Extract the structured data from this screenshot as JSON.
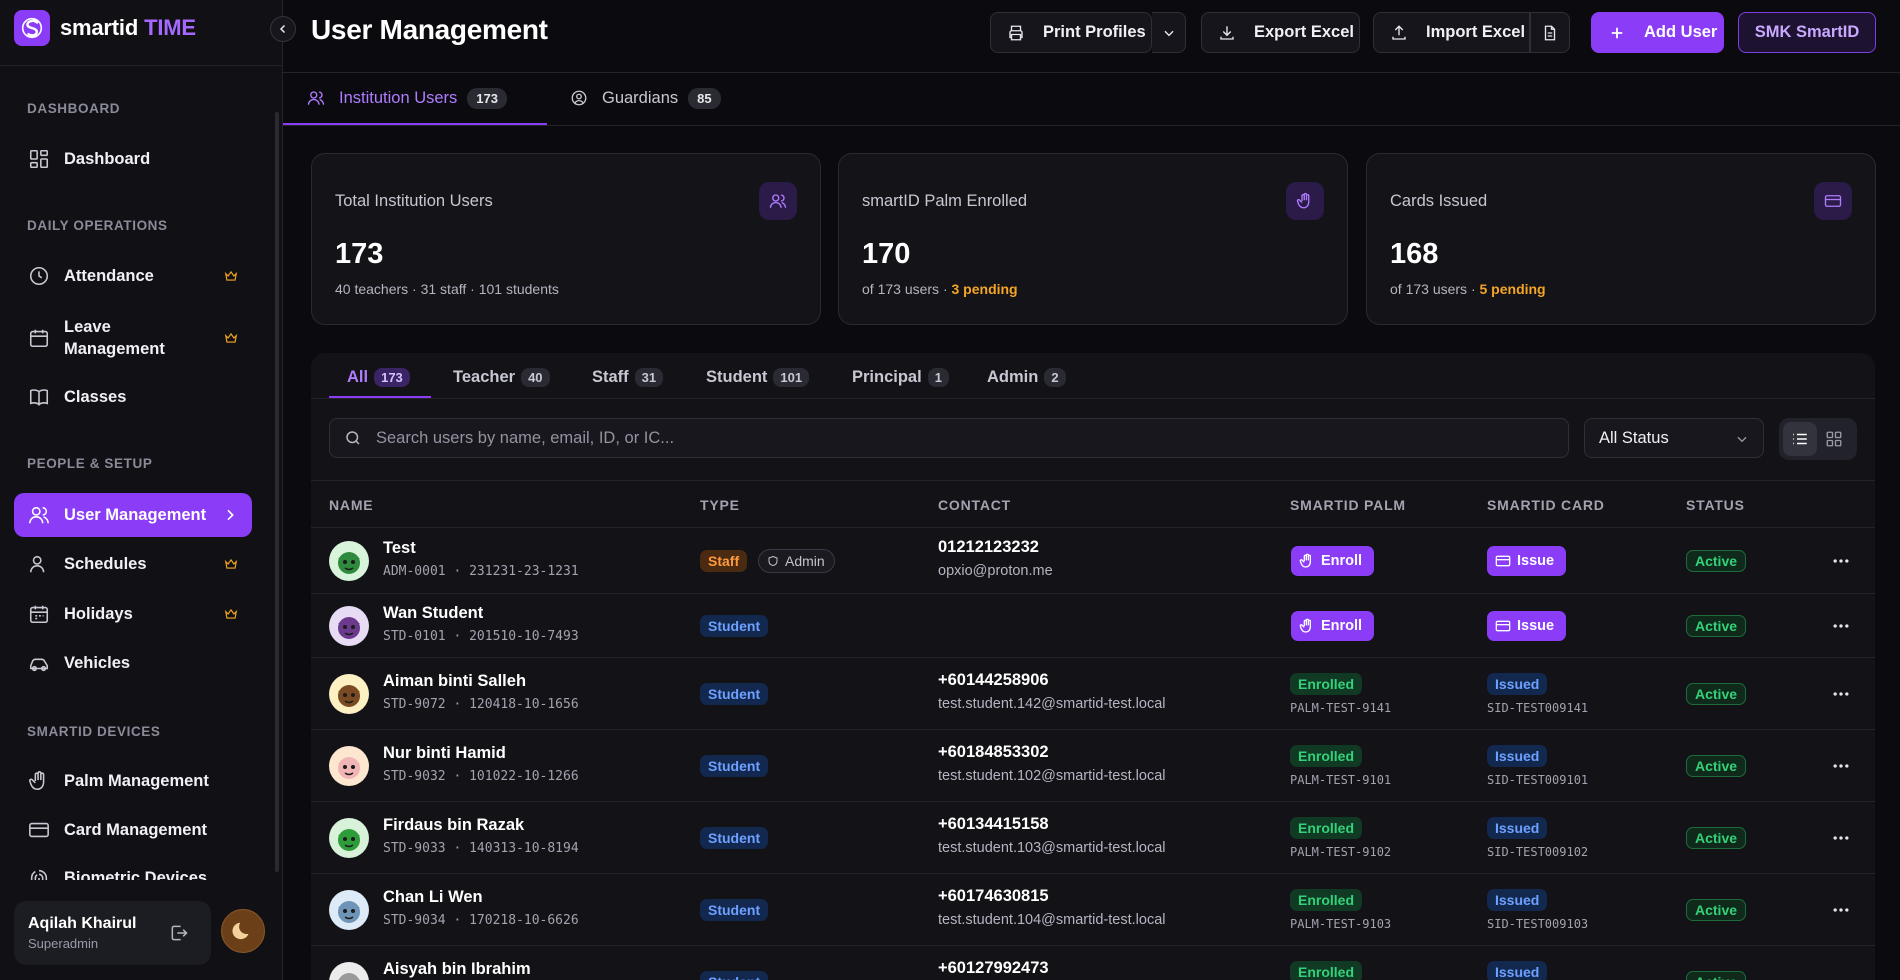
{
  "brand": {
    "name": "smartid",
    "accent": "TIME"
  },
  "sidebar": {
    "sections": [
      {
        "title": "DASHBOARD",
        "items": [
          {
            "label": "Dashboard",
            "icon": "dashboard-icon"
          }
        ]
      },
      {
        "title": "DAILY OPERATIONS",
        "items": [
          {
            "label": "Attendance",
            "icon": "clock-icon",
            "premium": true
          },
          {
            "label": "Leave Management",
            "icon": "calendar-icon",
            "premium": true
          },
          {
            "label": "Classes",
            "icon": "book-icon"
          }
        ]
      },
      {
        "title": "PEOPLE & SETUP",
        "items": [
          {
            "label": "User Management",
            "icon": "users-icon",
            "active": true
          },
          {
            "label": "Schedules",
            "icon": "user-icon",
            "premium": true
          },
          {
            "label": "Holidays",
            "icon": "calendar-icon",
            "premium": true
          },
          {
            "label": "Vehicles",
            "icon": "car-icon"
          }
        ]
      },
      {
        "title": "SMARTID DEVICES",
        "items": [
          {
            "label": "Palm Management",
            "icon": "palm-icon"
          },
          {
            "label": "Card Management",
            "icon": "card-icon"
          },
          {
            "label": "Biometric Devices",
            "icon": "fingerprint-icon"
          }
        ]
      }
    ],
    "user": {
      "name": "Aqilah Khairul",
      "role": "Superadmin"
    }
  },
  "header": {
    "title": "User Management",
    "print_label": "Print Profiles",
    "export_label": "Export Excel",
    "import_label": "Import Excel",
    "add_label": "Add User",
    "school_label": "SMK SmartID"
  },
  "main_tabs": [
    {
      "label": "Institution Users",
      "count": "173",
      "active": true
    },
    {
      "label": "Guardians",
      "count": "85"
    }
  ],
  "stats": [
    {
      "label": "Total Institution Users",
      "value": "173",
      "sub": "40 teachers · 31 staff · 101 students",
      "icon": "users-icon"
    },
    {
      "label": "smartID Palm Enrolled",
      "value": "170",
      "sub": "of 173 users · ",
      "pending": "3 pending",
      "icon": "palm-icon"
    },
    {
      "label": "Cards Issued",
      "value": "168",
      "sub": "of 173 users · ",
      "pending": "5 pending",
      "icon": "card-icon"
    }
  ],
  "filter_tabs": [
    {
      "label": "All",
      "count": "173",
      "active": true
    },
    {
      "label": "Teacher",
      "count": "40"
    },
    {
      "label": "Staff",
      "count": "31"
    },
    {
      "label": "Student",
      "count": "101"
    },
    {
      "label": "Principal",
      "count": "1"
    },
    {
      "label": "Admin",
      "count": "2"
    }
  ],
  "search": {
    "placeholder": "Search users by name, email, ID, or IC..."
  },
  "status_filter": {
    "value": "All Status"
  },
  "table": {
    "columns": [
      "NAME",
      "TYPE",
      "CONTACT",
      "SMARTID PALM",
      "SMARTID CARD",
      "STATUS"
    ],
    "rows": [
      {
        "name": "Test",
        "id": "ADM-0001 · 231231-23-1231",
        "type": "Staff",
        "role": "Admin",
        "phone": "01212123232",
        "email": "opxio@proton.me",
        "palm": "Enroll",
        "card": "Issue",
        "status": "Active",
        "avatar_color": "#2e8b3e",
        "avatar_bg": "#d8f5dc"
      },
      {
        "name": "Wan Student",
        "id": "STD-0101 · 201510-10-7493",
        "type": "Student",
        "phone": "",
        "email": "",
        "palm": "Enroll",
        "card": "Issue",
        "status": "Active",
        "avatar_color": "#6b3a8c",
        "avatar_bg": "#e8dcf5"
      },
      {
        "name": "Aiman binti Salleh",
        "id": "STD-9072 · 120418-10-1656",
        "type": "Student",
        "phone": "+60144258906",
        "email": "test.student.142@smartid-test.local",
        "palm": "Enrolled",
        "palm_id": "PALM-TEST-9141",
        "card": "Issued",
        "card_id": "SID-TEST009141",
        "status": "Active",
        "avatar_color": "#7a4a22",
        "avatar_bg": "#fdf0c2"
      },
      {
        "name": "Nur binti Hamid",
        "id": "STD-9032 · 101022-10-1266",
        "type": "Student",
        "phone": "+60184853302",
        "email": "test.student.102@smartid-test.local",
        "palm": "Enrolled",
        "palm_id": "PALM-TEST-9101",
        "card": "Issued",
        "card_id": "SID-TEST009101",
        "status": "Active",
        "avatar_color": "#f2b5b5",
        "avatar_bg": "#fde7d0"
      },
      {
        "name": "Firdaus bin Razak",
        "id": "STD-9033 · 140313-10-8194",
        "type": "Student",
        "phone": "+60134415158",
        "email": "test.student.103@smartid-test.local",
        "palm": "Enrolled",
        "palm_id": "PALM-TEST-9102",
        "card": "Issued",
        "card_id": "SID-TEST009102",
        "status": "Active",
        "avatar_color": "#2f9c3a",
        "avatar_bg": "#d7f2d9"
      },
      {
        "name": "Chan Li Wen",
        "id": "STD-9034 · 170218-10-6626",
        "type": "Student",
        "phone": "+60174630815",
        "email": "test.student.104@smartid-test.local",
        "palm": "Enrolled",
        "palm_id": "PALM-TEST-9103",
        "card": "Issued",
        "card_id": "SID-TEST009103",
        "status": "Active",
        "avatar_color": "#6e94b8",
        "avatar_bg": "#dcebf7"
      },
      {
        "name": "Aisyah bin Ibrahim",
        "id": "",
        "type": "Student",
        "phone": "+60127992473",
        "email": "",
        "palm": "Enrolled",
        "card": "Issued",
        "status": "Active",
        "avatar_color": "#9a9a9a",
        "avatar_bg": "#ececec"
      }
    ]
  }
}
